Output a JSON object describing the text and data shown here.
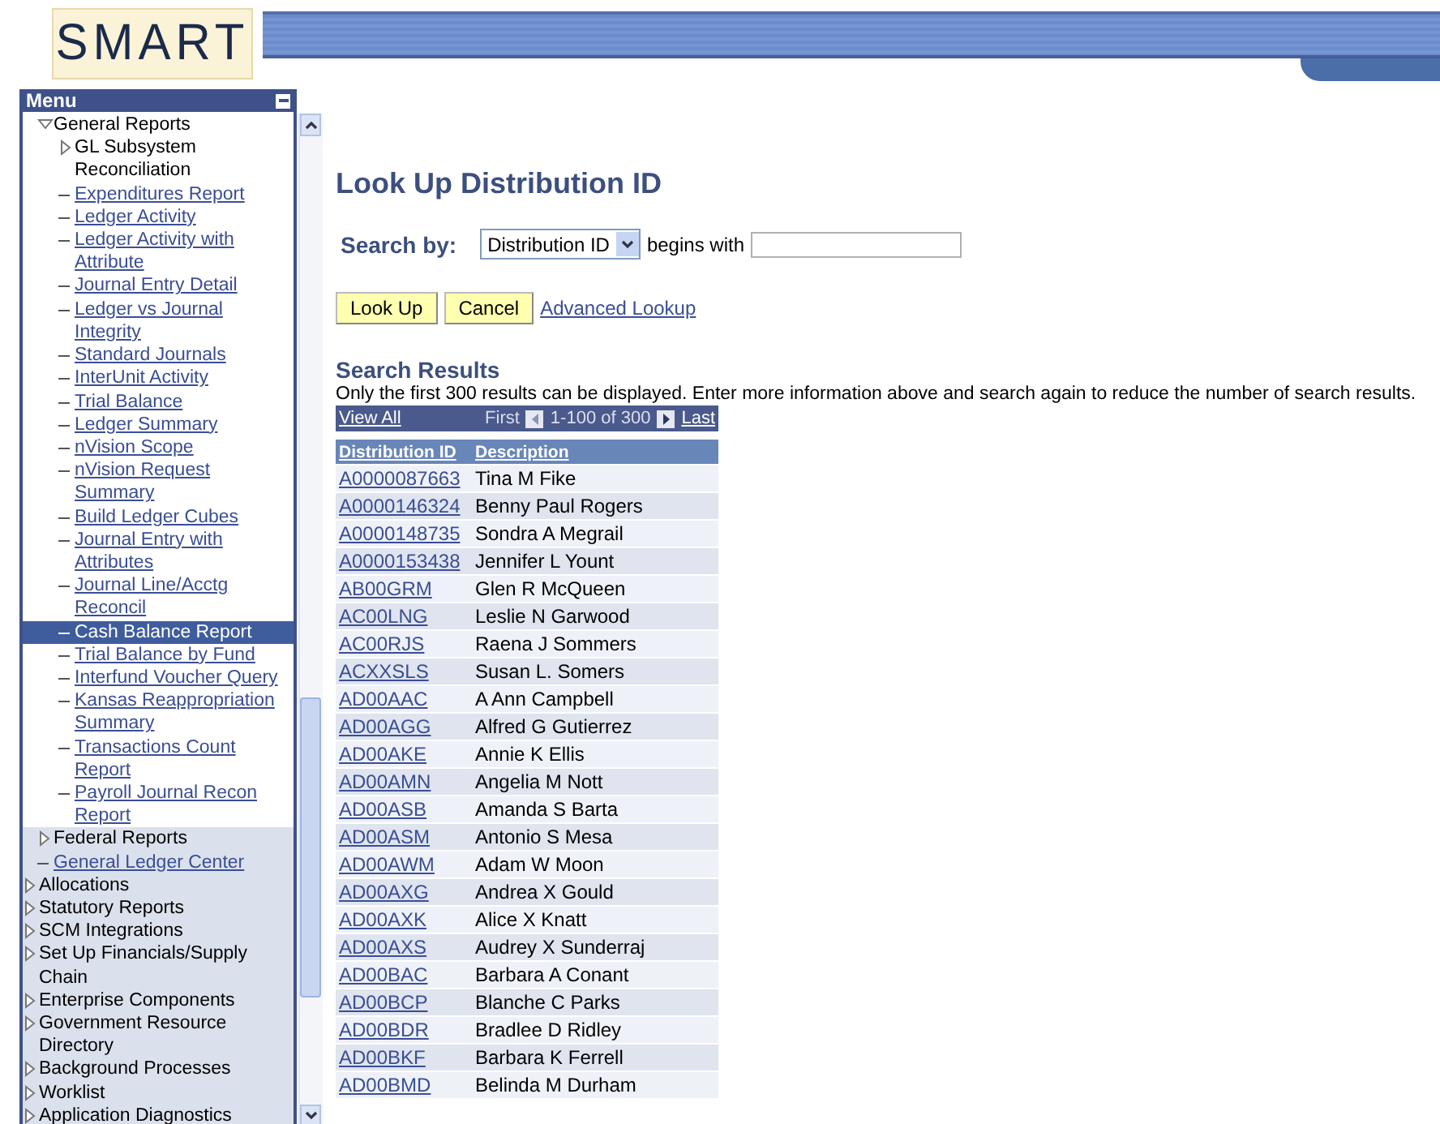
{
  "logo": {
    "text": "SMART"
  },
  "menu": {
    "title": "Menu",
    "subitems": [
      {
        "kind": "folder",
        "label": "General Reports",
        "expanded": true,
        "children": [
          {
            "kind": "folder",
            "label": "GL Subsystem Reconciliation",
            "expanded": false,
            "selected": false
          },
          {
            "kind": "link",
            "label": "Expenditures Report",
            "selected": false
          },
          {
            "kind": "link",
            "label": "Ledger Activity",
            "selected": false
          },
          {
            "kind": "link",
            "label": "Ledger Activity with Attribute",
            "selected": false
          },
          {
            "kind": "link",
            "label": "Journal Entry Detail",
            "selected": false
          },
          {
            "kind": "link",
            "label": "Ledger vs Journal Integrity",
            "selected": false
          },
          {
            "kind": "link",
            "label": "Standard Journals",
            "selected": false
          },
          {
            "kind": "link",
            "label": "InterUnit Activity",
            "selected": false
          },
          {
            "kind": "link",
            "label": "Trial Balance",
            "selected": false
          },
          {
            "kind": "link",
            "label": "Ledger Summary",
            "selected": false
          },
          {
            "kind": "link",
            "label": "nVision Scope",
            "selected": false
          },
          {
            "kind": "link",
            "label": "nVision Request Summary",
            "selected": false
          },
          {
            "kind": "link",
            "label": "Build Ledger Cubes",
            "selected": false
          },
          {
            "kind": "link",
            "label": "Journal Entry with Attributes",
            "selected": false
          },
          {
            "kind": "link",
            "label": "Journal Line/Acctg Reconcil",
            "selected": false
          },
          {
            "kind": "link",
            "label": "Cash Balance Report",
            "selected": true
          },
          {
            "kind": "link",
            "label": "Trial Balance by Fund",
            "selected": false
          },
          {
            "kind": "link",
            "label": "Interfund Voucher Query",
            "selected": false
          },
          {
            "kind": "link",
            "label": "Kansas Reappropriation Summary",
            "selected": false
          },
          {
            "kind": "link",
            "label": "Transactions Count Report",
            "selected": false
          },
          {
            "kind": "link",
            "label": "Payroll Journal Recon Report",
            "selected": false
          }
        ]
      },
      {
        "kind": "folder",
        "label": "Federal Reports",
        "expanded": false
      },
      {
        "kind": "link",
        "label": "General Ledger Center"
      }
    ],
    "items": [
      {
        "kind": "folder",
        "label": "Allocations",
        "expanded": false
      },
      {
        "kind": "folder",
        "label": "Statutory Reports",
        "expanded": false
      },
      {
        "kind": "folder",
        "label": "SCM Integrations",
        "expanded": false
      },
      {
        "kind": "folder",
        "label": "Set Up Financials/Supply Chain",
        "expanded": false
      },
      {
        "kind": "folder",
        "label": "Enterprise Components",
        "expanded": false
      },
      {
        "kind": "folder",
        "label": "Government Resource Directory",
        "expanded": false
      },
      {
        "kind": "folder",
        "label": "Background Processes",
        "expanded": false
      },
      {
        "kind": "folder",
        "label": "Worklist",
        "expanded": false
      },
      {
        "kind": "folder",
        "label": "Application Diagnostics",
        "expanded": false
      }
    ]
  },
  "page": {
    "title": "Look Up Distribution ID",
    "search_label": "Search by:",
    "search_by": "Distribution ID",
    "operator": "begins with",
    "buttons": [
      "Look Up",
      "Cancel"
    ],
    "advanced_link": "Advanced Lookup",
    "results_title": "Search Results",
    "results_note": "Only the first 300 results can be displayed. Enter more information above and search again to reduce the number of search results."
  },
  "table": {
    "view_all": "View All",
    "first": "First",
    "range": "1-100 of 300",
    "last": "Last",
    "columns": [
      "Distribution ID",
      "Description"
    ],
    "rows": [
      [
        "A0000087663",
        "Tina M Fike"
      ],
      [
        "A0000146324",
        "Benny Paul Rogers"
      ],
      [
        "A0000148735",
        "Sondra A Megrail"
      ],
      [
        "A0000153438",
        "Jennifer L Yount"
      ],
      [
        "AB00GRM",
        "Glen R McQueen"
      ],
      [
        "AC00LNG",
        "Leslie N Garwood"
      ],
      [
        "AC00RJS",
        "Raena J Sommers"
      ],
      [
        "ACXXSLS",
        "Susan L. Somers"
      ],
      [
        "AD00AAC",
        "A Ann Campbell"
      ],
      [
        "AD00AGG",
        "Alfred G Gutierrez"
      ],
      [
        "AD00AKE",
        "Annie K Ellis"
      ],
      [
        "AD00AMN",
        "Angelia M Nott"
      ],
      [
        "AD00ASB",
        "Amanda S Barta"
      ],
      [
        "AD00ASM",
        "Antonio S Mesa"
      ],
      [
        "AD00AWM",
        "Adam W Moon"
      ],
      [
        "AD00AXG",
        "Andrea X Gould"
      ],
      [
        "AD00AXK",
        "Alice X Knatt"
      ],
      [
        "AD00AXS",
        "Audrey X Sunderraj"
      ],
      [
        "AD00BAC",
        "Barbara A Conant"
      ],
      [
        "AD00BCP",
        "Blanche C Parks"
      ],
      [
        "AD00BDR",
        "Bradlee D Ridley"
      ],
      [
        "AD00BKF",
        "Barbara K Ferrell"
      ],
      [
        "AD00BMD",
        "Belinda M Durham"
      ]
    ]
  }
}
